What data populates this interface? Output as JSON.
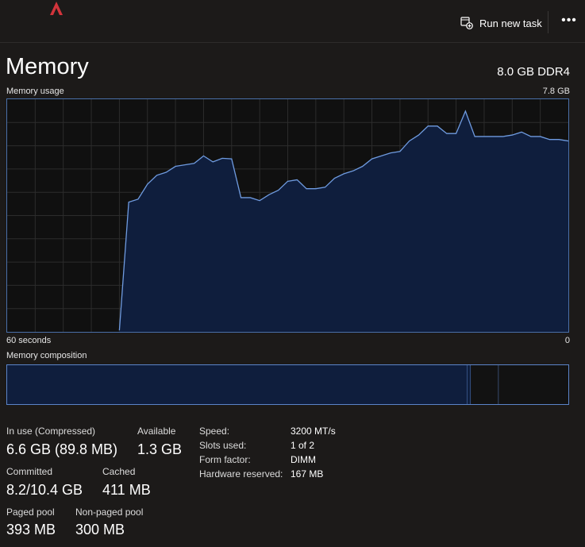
{
  "header": {
    "run_new_task_label": "Run new task",
    "more_icon": "ellipsis-icon"
  },
  "page": {
    "title": "Memory",
    "spec": "8.0 GB DDR4"
  },
  "usage_chart": {
    "label": "Memory usage",
    "max_label": "7.8 GB",
    "time_left_label": "60 seconds",
    "time_right_label": "0",
    "line_color": "#6f9be0",
    "fill_color": "#0f1e3d"
  },
  "composition": {
    "label": "Memory composition",
    "segments": [
      {
        "name": "in-use",
        "value_gb": 6.6
      },
      {
        "name": "modified",
        "value_gb": 0.05
      },
      {
        "name": "standby",
        "value_gb": 0.4
      },
      {
        "name": "free",
        "value_gb": 1.0
      }
    ]
  },
  "stats": {
    "in_use_label": "In use (Compressed)",
    "in_use_value": "6.6 GB (89.8 MB)",
    "available_label": "Available",
    "available_value": "1.3 GB",
    "committed_label": "Committed",
    "committed_value": "8.2/10.4 GB",
    "cached_label": "Cached",
    "cached_value": "411 MB",
    "paged_pool_label": "Paged pool",
    "paged_pool_value": "393 MB",
    "nonpaged_pool_label": "Non-paged pool",
    "nonpaged_pool_value": "300 MB"
  },
  "details": {
    "speed_label": "Speed:",
    "speed_value": "3200 MT/s",
    "slots_label": "Slots used:",
    "slots_value": "1 of 2",
    "form_label": "Form factor:",
    "form_value": "DIMM",
    "reserved_label": "Hardware reserved:",
    "reserved_value": "167 MB"
  },
  "chart_data": {
    "type": "area",
    "ylim": [
      0,
      7.8
    ],
    "xlim": [
      60,
      0
    ],
    "x": [
      60,
      59,
      58,
      57,
      56,
      55,
      54,
      53,
      52,
      51,
      50,
      49,
      48,
      47,
      46,
      45,
      44,
      43,
      42,
      41,
      40,
      39,
      38,
      37,
      36,
      35,
      34,
      33,
      32,
      31,
      30,
      29,
      28,
      27,
      26,
      25,
      24,
      23,
      22,
      21,
      20,
      19,
      18,
      17,
      16,
      15,
      14,
      13,
      12,
      11,
      10,
      9,
      8,
      7,
      6,
      5,
      4,
      3,
      2,
      1,
      0
    ],
    "series": [
      {
        "values": [
          null,
          null,
          null,
          null,
          null,
          null,
          null,
          null,
          null,
          null,
          null,
          null,
          0.05,
          4.35,
          4.45,
          4.95,
          5.25,
          5.35,
          5.55,
          5.6,
          5.65,
          5.9,
          5.7,
          5.82,
          5.8,
          4.5,
          4.5,
          4.4,
          4.6,
          4.75,
          5.05,
          5.1,
          4.8,
          4.8,
          4.85,
          5.15,
          5.3,
          5.4,
          5.55,
          5.8,
          5.9,
          6.0,
          6.05,
          6.4,
          6.6,
          6.9,
          6.9,
          6.65,
          6.65,
          7.4,
          6.55,
          6.55,
          6.55,
          6.55,
          6.6,
          6.7,
          6.55,
          6.55,
          6.45,
          6.45,
          6.4
        ]
      }
    ],
    "grid": true
  }
}
